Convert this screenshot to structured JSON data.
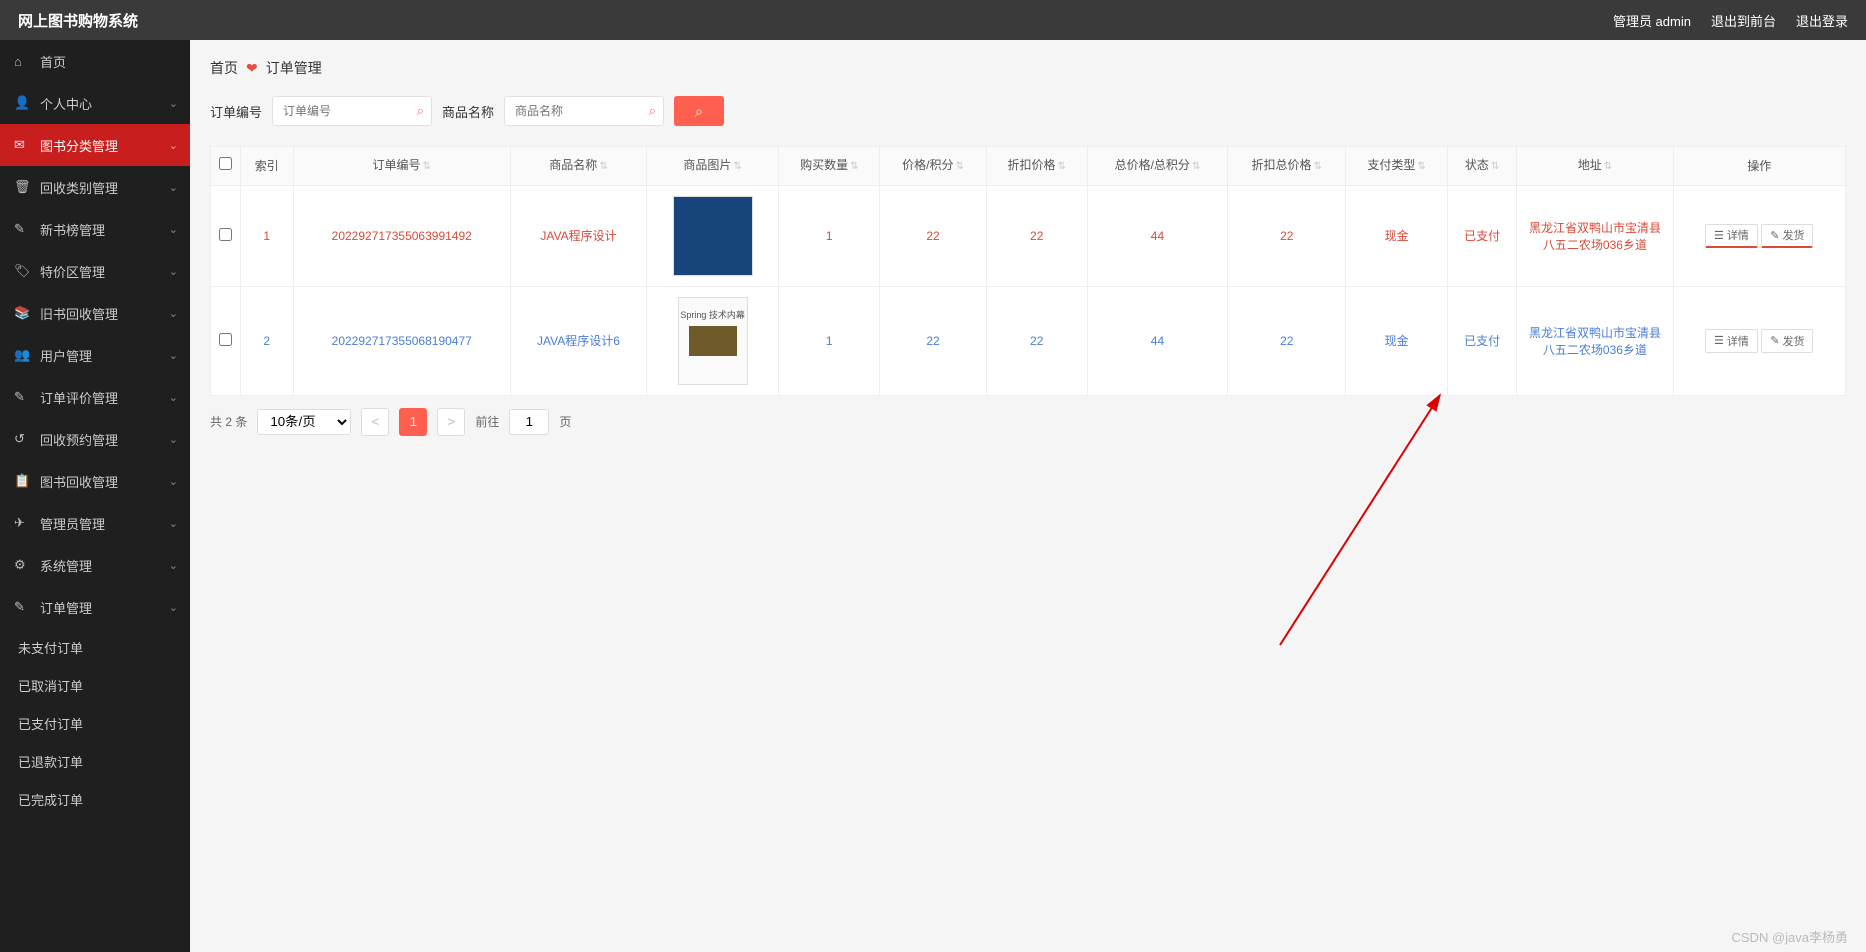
{
  "app": {
    "title": "网上图书购物系统"
  },
  "topbar": {
    "admin": "管理员 admin",
    "toFront": "退出到前台",
    "logout": "退出登录"
  },
  "sidebar": {
    "items": [
      {
        "icon": "⌂",
        "label": "首页",
        "active": false,
        "hasChev": false
      },
      {
        "icon": "👤",
        "label": "个人中心",
        "active": false,
        "hasChev": true
      },
      {
        "icon": "✉",
        "label": "图书分类管理",
        "active": true,
        "hasChev": true
      },
      {
        "icon": "🗑",
        "label": "回收类别管理",
        "active": false,
        "hasChev": true
      },
      {
        "icon": "✎",
        "label": "新书榜管理",
        "active": false,
        "hasChev": true
      },
      {
        "icon": "🏷",
        "label": "特价区管理",
        "active": false,
        "hasChev": true
      },
      {
        "icon": "📚",
        "label": "旧书回收管理",
        "active": false,
        "hasChev": true
      },
      {
        "icon": "👥",
        "label": "用户管理",
        "active": false,
        "hasChev": true
      },
      {
        "icon": "✎",
        "label": "订单评价管理",
        "active": false,
        "hasChev": true
      },
      {
        "icon": "↺",
        "label": "回收预约管理",
        "active": false,
        "hasChev": true
      },
      {
        "icon": "📋",
        "label": "图书回收管理",
        "active": false,
        "hasChev": true
      },
      {
        "icon": "✈",
        "label": "管理员管理",
        "active": false,
        "hasChev": true
      },
      {
        "icon": "⚙",
        "label": "系统管理",
        "active": false,
        "hasChev": true
      },
      {
        "icon": "✎",
        "label": "订单管理",
        "active": false,
        "hasChev": true
      }
    ],
    "subItems": [
      "未支付订单",
      "已取消订单",
      "已支付订单",
      "已退款订单",
      "已完成订单"
    ]
  },
  "crumb": {
    "home": "首页",
    "current": "订单管理"
  },
  "filters": {
    "orderNoLabel": "订单编号",
    "orderNoPlaceholder": "订单编号",
    "productLabel": "商品名称",
    "productPlaceholder": "商品名称"
  },
  "table": {
    "headers": [
      "",
      "索引",
      "订单编号",
      "商品名称",
      "商品图片",
      "购买数量",
      "价格/积分",
      "折扣价格",
      "总价格/总积分",
      "折扣总价格",
      "支付类型",
      "状态",
      "地址",
      "操作"
    ],
    "rows": [
      {
        "idx": "1",
        "orderNo": "202292717355063991492",
        "name": "JAVA程序设计",
        "qty": "1",
        "price": "22",
        "disc": "22",
        "total": "44",
        "discTotal": "22",
        "payType": "现金",
        "status": "已支付",
        "addr": "黑龙江省双鸭山市宝清县八五二农场036乡道"
      },
      {
        "idx": "2",
        "orderNo": "202292717355068190477",
        "name": "JAVA程序设计6",
        "qty": "1",
        "price": "22",
        "disc": "22",
        "total": "44",
        "discTotal": "22",
        "payType": "现金",
        "status": "已支付",
        "addr": "黑龙江省双鸭山市宝清县八五二农场036乡道"
      }
    ],
    "ops": {
      "detail": "详情",
      "ship": "发货"
    }
  },
  "pagination": {
    "total": "共 2 条",
    "perPage": "10条/页",
    "page": "1",
    "jumpPre": "前往",
    "jumpPost": "页"
  },
  "watermark": "CSDN @java李杨勇"
}
